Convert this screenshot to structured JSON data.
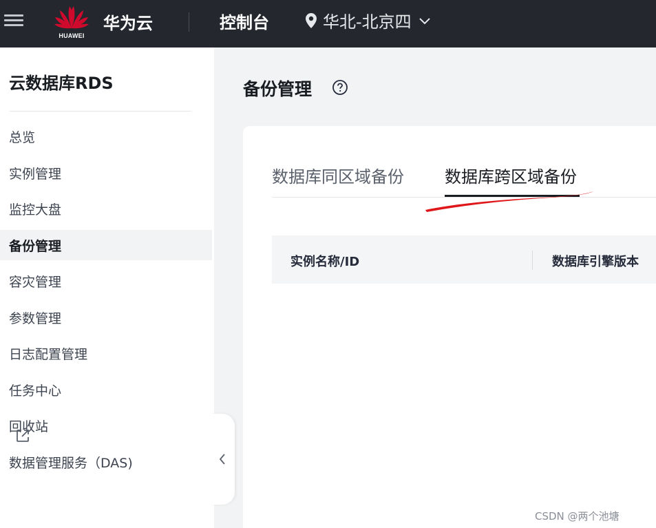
{
  "topbar": {
    "logo_text": "HUAWEI",
    "brand": "华为云",
    "console": "控制台",
    "region": "华北-北京四"
  },
  "sidebar": {
    "title": "云数据库RDS",
    "items": [
      {
        "label": "总览"
      },
      {
        "label": "实例管理"
      },
      {
        "label": "监控大盘"
      },
      {
        "label": "备份管理",
        "active": true
      },
      {
        "label": "容灾管理"
      },
      {
        "label": "参数管理"
      },
      {
        "label": "日志配置管理"
      },
      {
        "label": "任务中心"
      },
      {
        "label": "回收站"
      },
      {
        "label": "数据管理服务（DAS)"
      }
    ]
  },
  "main": {
    "page_title": "备份管理",
    "tabs": [
      {
        "label": "数据库同区域备份"
      },
      {
        "label": "数据库跨区域备份",
        "active": true
      }
    ],
    "table": {
      "columns": [
        "实例名称/ID",
        "数据库引擎版本"
      ]
    }
  },
  "watermark": "CSDN @两个池塘",
  "colors": {
    "topbar_bg": "#24282e",
    "huawei_red": "#cf0a2c",
    "annotation_red": "#e0171a"
  }
}
